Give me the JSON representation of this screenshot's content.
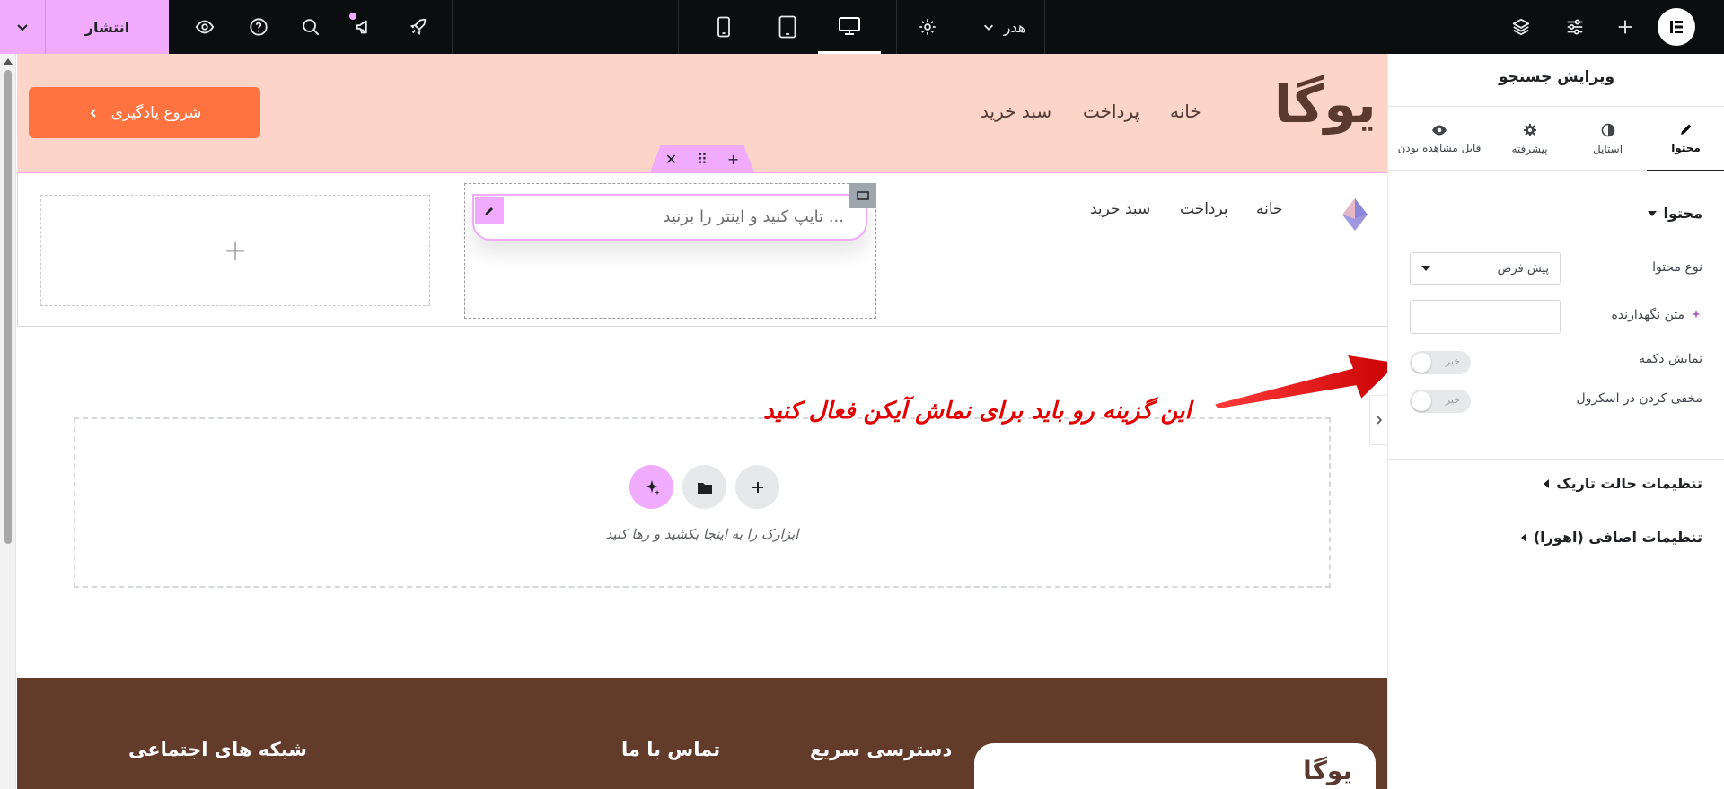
{
  "topbar": {
    "publish_label": "انتشار",
    "header_selector": "هدر",
    "logo_letter": "E"
  },
  "hero": {
    "brand": "یوگا",
    "nav": [
      "خانه",
      "پرداخت",
      "سبد خرید"
    ],
    "cta_label": "شروع یادگیری"
  },
  "header2": {
    "nav": [
      "خانه",
      "پرداخت",
      "سبد خرید"
    ],
    "search_placeholder": "تایپ کنید و اینتر را بزنید ..."
  },
  "dropzone": {
    "hint": "ابزارک را به اینجا بکشید و رها کنید"
  },
  "annotation": "این گزینه رو باید برای نماش آیکن فعال کنید",
  "footer": {
    "headings": [
      "شبکه های اجتماعی",
      "تماس با ما",
      "دسترسی سریع"
    ],
    "card_brand": "یوگا"
  },
  "panel": {
    "title": "ویرایش جستجو",
    "tabs": [
      "محتوا",
      "استایل",
      "پیشرفته",
      "قابل مشاهده بودن"
    ],
    "section_content": "محتوا",
    "content_type_label": "نوع محتوا",
    "content_type_value": "پیش فرض",
    "placeholder_label": "متن نگهدارنده",
    "show_button_label": "نمایش دکمه",
    "show_button_state": "خیر",
    "hide_on_scroll_label": "مخفی کردن در اسکرول",
    "hide_on_scroll_state": "خیر",
    "dark_mode_section": "تنظیمات حالت تاریک",
    "extra_section": "تنظیمات اضافی (اهورا)"
  },
  "colors": {
    "accent": "#f0abfc",
    "cta": "#fe7340",
    "hero_bg": "#fdd5c8",
    "footer_bg": "#633b2b",
    "annotation": "#e20000"
  }
}
